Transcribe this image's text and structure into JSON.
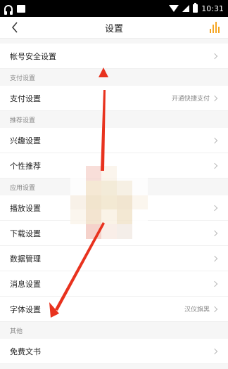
{
  "status_bar": {
    "time": "10:31"
  },
  "header": {
    "title": "设置"
  },
  "sections": [
    {
      "rows": [
        {
          "label": "帐号安全设置",
          "value": ""
        }
      ]
    },
    {
      "header": "支付设置",
      "rows": [
        {
          "label": "支付设置",
          "value": "开通快捷支付"
        }
      ]
    },
    {
      "header": "推荐设置",
      "rows": [
        {
          "label": "兴趣设置",
          "value": ""
        },
        {
          "label": "个性推荐",
          "value": ""
        }
      ]
    },
    {
      "header": "应用设置",
      "rows": [
        {
          "label": "播放设置",
          "value": ""
        },
        {
          "label": "下载设置",
          "value": ""
        },
        {
          "label": "数据管理",
          "value": ""
        },
        {
          "label": "消息设置",
          "value": ""
        },
        {
          "label": "字体设置",
          "value": "汉仪旗黑"
        }
      ]
    },
    {
      "header": "其他",
      "rows": [
        {
          "label": "免费文书",
          "value": ""
        }
      ]
    }
  ],
  "colors": {
    "accent": "#f5a623",
    "annotation_arrow": "#e8321e"
  }
}
